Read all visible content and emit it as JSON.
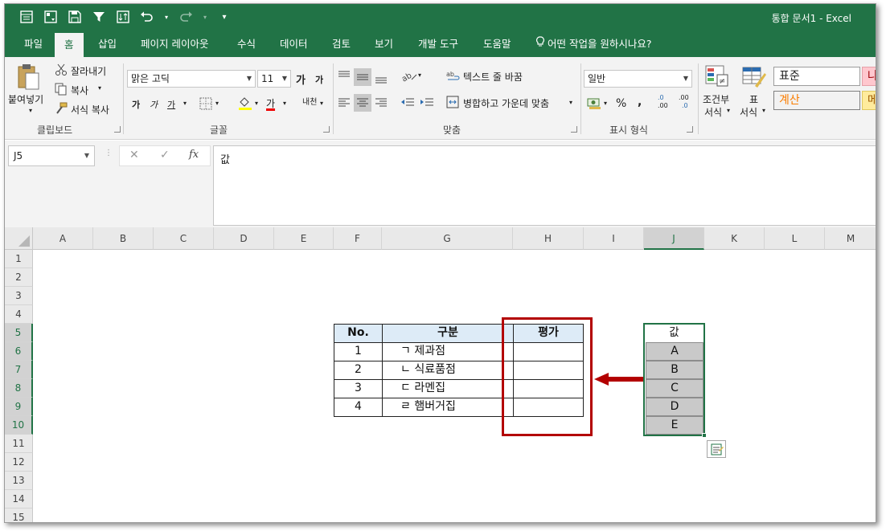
{
  "titlebar": {
    "title": "통합 문서1  -  Excel",
    "qat_icons": [
      "form-icon",
      "pivot-icon",
      "save-icon",
      "filter-icon",
      "sort-icon",
      "undo-icon",
      "redo-icon",
      "customize-icon"
    ]
  },
  "tabs": [
    "파일",
    "홈",
    "삽입",
    "페이지 레이아웃",
    "수식",
    "데이터",
    "검토",
    "보기",
    "개발 도구",
    "도움말",
    "어떤 작업을 원하시나요?"
  ],
  "active_tab": "홈",
  "ribbon": {
    "clipboard": {
      "paste": "붙여넣기",
      "cut": "잘라내기",
      "copy": "복사",
      "format_painter": "서식 복사",
      "group": "클립보드"
    },
    "font": {
      "name": "맑은 고딕",
      "size": "11",
      "grow": "가",
      "shrink": "가",
      "bold": "가",
      "italic": "가",
      "underline": "가",
      "color_a": "가",
      "phonetic": "내천",
      "group": "글꼴"
    },
    "alignment": {
      "wrap": "텍스트 줄 바꿈",
      "merge": "병합하고 가운데 맞춤",
      "group": "맞춤"
    },
    "number": {
      "format": "일반",
      "percent": "%",
      "comma": ",",
      "inc": ".0",
      "inc2": ".00",
      "dec": ".00",
      "dec2": ".0",
      "group": "표시 형식"
    },
    "styles": {
      "conditional": "조건부",
      "conditional2": "서식",
      "table": "표",
      "table2": "서식",
      "normal": "표준",
      "calc": "계산",
      "bad": "나",
      "neutral": "메"
    },
    "colors": {
      "accent": "#217346",
      "red_box": "#b30000",
      "header_fill": "#ddebf7",
      "list_fill": "#c9c9c9"
    }
  },
  "formula_bar": {
    "name_box": "J5",
    "cancel": "✕",
    "enter": "✓",
    "fx": "fx",
    "content": "값"
  },
  "columns": [
    "A",
    "B",
    "C",
    "D",
    "E",
    "F",
    "G",
    "H",
    "I",
    "J",
    "K",
    "L",
    "M"
  ],
  "rows": [
    "1",
    "2",
    "3",
    "4",
    "5",
    "6",
    "7",
    "8",
    "9",
    "10",
    "11",
    "12",
    "13",
    "14",
    "15"
  ],
  "selected_column": "J",
  "selected_rows": [
    "5",
    "6",
    "7",
    "8",
    "9",
    "10"
  ],
  "table": {
    "headers": [
      "No.",
      "구분",
      "평가"
    ],
    "rows": [
      {
        "no": "1",
        "category": "ㄱ 제과점",
        "eval": ""
      },
      {
        "no": "2",
        "category": "ㄴ 식료품점",
        "eval": ""
      },
      {
        "no": "3",
        "category": "ㄷ 라멘집",
        "eval": ""
      },
      {
        "no": "4",
        "category": "ㄹ 햄버거집",
        "eval": ""
      }
    ]
  },
  "value_list": {
    "header": "값",
    "items": [
      "A",
      "B",
      "C",
      "D",
      "E"
    ]
  }
}
